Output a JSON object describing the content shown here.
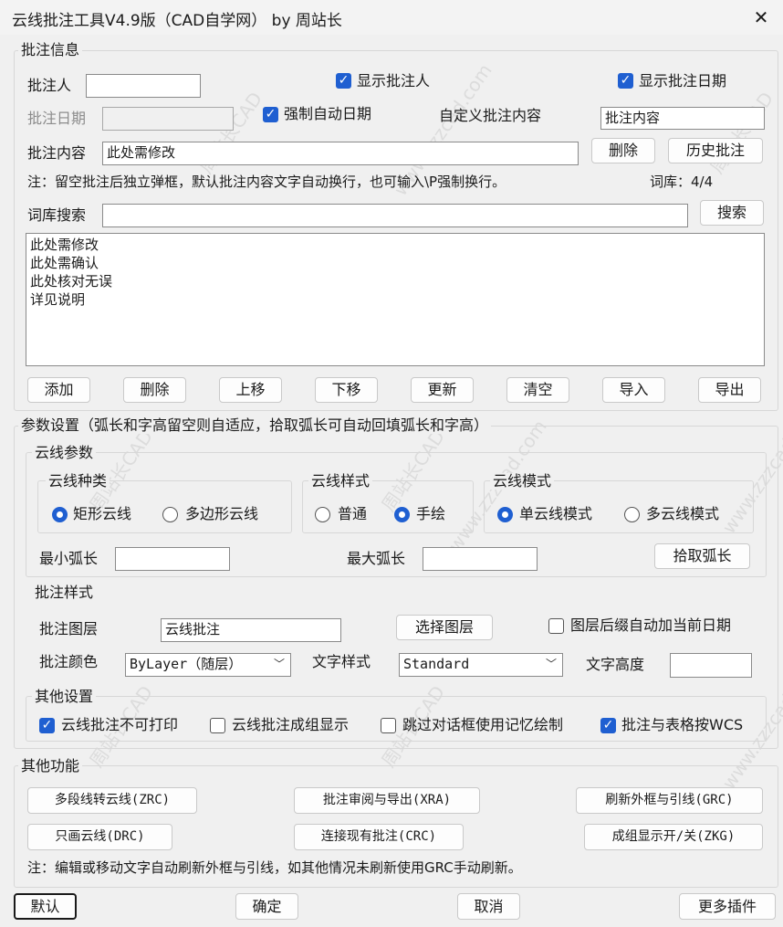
{
  "window": {
    "title": "云线批注工具V4.9版（CAD自学网） by 周站长",
    "close": "✕"
  },
  "annot_info": {
    "group_label": "批注信息",
    "person_label": "批注人",
    "person_value": "",
    "show_person": "显示批注人",
    "show_date": "显示批注日期",
    "date_label": "批注日期",
    "date_value": "",
    "force_auto_date": "强制自动日期",
    "custom_label": "自定义批注内容",
    "custom_value": "批注内容",
    "content_label": "批注内容",
    "content_value": "此处需修改",
    "delete_btn": "删除",
    "history_btn": "历史批注",
    "note": "注：留空批注后独立弹框，默认批注内容文字自动换行，也可输入\\P强制换行。",
    "lib_count": "词库：4/4",
    "search_label": "词库搜索",
    "search_value": "",
    "search_btn": "搜索",
    "list_items": [
      "此处需修改",
      "此处需确认",
      "此处核对无误",
      "详见说明"
    ],
    "buttons": [
      "添加",
      "删除",
      "上移",
      "下移",
      "更新",
      "清空",
      "导入",
      "导出"
    ]
  },
  "params": {
    "group_label": "参数设置（弧长和字高留空则自适应，拾取弧长可自动回填弧长和字高）",
    "cloud_params": "云线参数",
    "cloud_type": {
      "label": "云线种类",
      "opt1": "矩形云线",
      "opt2": "多边形云线"
    },
    "cloud_style": {
      "label": "云线样式",
      "opt1": "普通",
      "opt2": "手绘"
    },
    "cloud_mode": {
      "label": "云线模式",
      "opt1": "单云线模式",
      "opt2": "多云线模式"
    },
    "min_arc_label": "最小弧长",
    "min_arc_value": "",
    "max_arc_label": "最大弧长",
    "max_arc_value": "",
    "pick_arc_btn": "拾取弧长",
    "annot_style": "批注样式",
    "layer_label": "批注图层",
    "layer_value": "云线批注",
    "select_layer_btn": "选择图层",
    "layer_date_cb": "图层后缀自动加当前日期",
    "color_label": "批注颜色",
    "color_value": "ByLayer（随层）",
    "textstyle_label": "文字样式",
    "textstyle_value": "Standard",
    "textheight_label": "文字高度",
    "textheight_value": "",
    "other_settings": "其他设置",
    "cb_noprint": "云线批注不可打印",
    "cb_group": "云线批注成组显示",
    "cb_skip": "跳过对话框使用记忆绘制",
    "cb_wcs": "批注与表格按WCS"
  },
  "functions": {
    "group_label": "其他功能",
    "btn_zrc": "多段线转云线(ZRC)",
    "btn_xra": "批注审阅与导出(XRA)",
    "btn_grc": "刷新外框与引线(GRC)",
    "btn_drc": "只画云线(DRC)",
    "btn_crc": "连接现有批注(CRC)",
    "btn_zkg": "成组显示开/关(ZKG)",
    "note": "注：编辑或移动文字自动刷新外框与引线，如其他情况未刷新使用GRC手动刷新。"
  },
  "footer": {
    "default_btn": "默认",
    "ok_btn": "确定",
    "cancel_btn": "取消",
    "more_btn": "更多插件"
  },
  "watermark": {
    "text1": "周站长CAD",
    "text2": "www.zzzcad.com"
  },
  "colors": {
    "accent": "#1f5fd1",
    "background": "#f0f0f0"
  }
}
